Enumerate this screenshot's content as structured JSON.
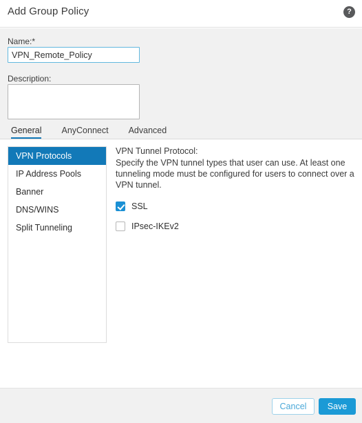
{
  "header": {
    "title": "Add Group Policy",
    "help_icon": "help-circle-icon",
    "help_glyph": "?"
  },
  "form": {
    "name_label": "Name:*",
    "name_value": "VPN_Remote_Policy",
    "name_placeholder": "",
    "description_label": "Description:",
    "description_value": "",
    "description_placeholder": ""
  },
  "tabs": [
    {
      "label": "General",
      "active": true
    },
    {
      "label": "AnyConnect",
      "active": false
    },
    {
      "label": "Advanced",
      "active": false
    }
  ],
  "sidebar": {
    "items": [
      {
        "label": "VPN Protocols",
        "selected": true
      },
      {
        "label": "IP Address Pools",
        "selected": false
      },
      {
        "label": "Banner",
        "selected": false
      },
      {
        "label": "DNS/WINS",
        "selected": false
      },
      {
        "label": "Split Tunneling",
        "selected": false
      }
    ]
  },
  "detail": {
    "heading": "VPN Tunnel Protocol:",
    "description": "Specify the VPN tunnel types that user can use. At least one tunneling mode must be configured for users to connect over a VPN tunnel.",
    "options": [
      {
        "label": "SSL",
        "checked": true
      },
      {
        "label": "IPsec-IKEv2",
        "checked": false
      }
    ]
  },
  "footer": {
    "cancel_label": "Cancel",
    "save_label": "Save"
  },
  "colors": {
    "accent_blue": "#1279b8",
    "save_blue": "#1b9ad6",
    "cancel_blue": "#4aa8d8",
    "checkbox_blue": "#1b90d4",
    "band_gray": "#f1f1f1",
    "focus_border": "#62b8de"
  }
}
